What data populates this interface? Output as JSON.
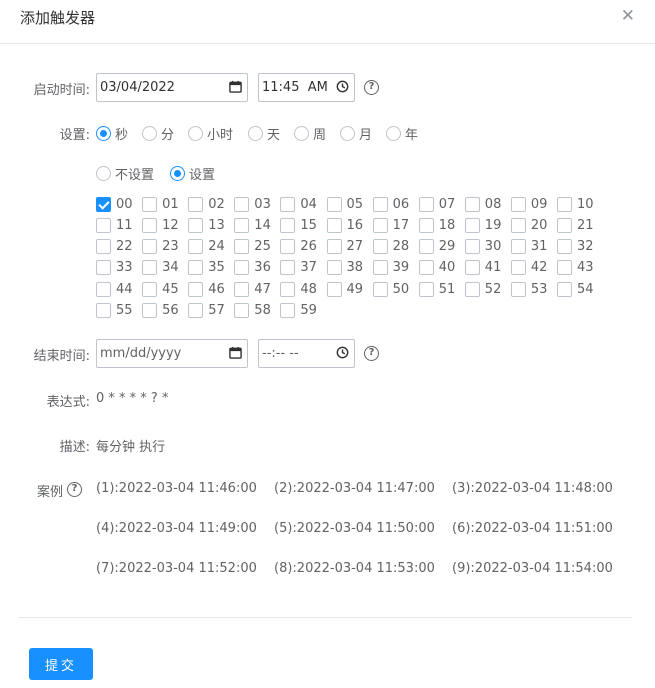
{
  "dialog": {
    "title": "添加触发器",
    "close_icon": "close-icon"
  },
  "start": {
    "label": "启动时间:",
    "date_value": "03/04/2022",
    "time_value": "11:45  AM",
    "date_icon": "calendar-icon",
    "time_icon": "clock-icon",
    "help": "?"
  },
  "settings": {
    "label": "设置:",
    "units": [
      {
        "label": "秒",
        "checked": true
      },
      {
        "label": "分",
        "checked": false
      },
      {
        "label": "小时",
        "checked": false
      },
      {
        "label": "天",
        "checked": false
      },
      {
        "label": "周",
        "checked": false
      },
      {
        "label": "月",
        "checked": false
      },
      {
        "label": "年",
        "checked": false
      }
    ],
    "modes": [
      {
        "label": "不设置",
        "checked": false
      },
      {
        "label": "设置",
        "checked": true
      }
    ],
    "seconds": [
      "00",
      "01",
      "02",
      "03",
      "04",
      "05",
      "06",
      "07",
      "08",
      "09",
      "10",
      "11",
      "12",
      "13",
      "14",
      "15",
      "16",
      "17",
      "18",
      "19",
      "20",
      "21",
      "22",
      "23",
      "24",
      "25",
      "26",
      "27",
      "28",
      "29",
      "30",
      "31",
      "32",
      "33",
      "34",
      "35",
      "36",
      "37",
      "38",
      "39",
      "40",
      "41",
      "42",
      "43",
      "44",
      "45",
      "46",
      "47",
      "48",
      "49",
      "50",
      "51",
      "52",
      "53",
      "54",
      "55",
      "56",
      "57",
      "58",
      "59"
    ],
    "checked_seconds": [
      "00"
    ]
  },
  "end": {
    "label": "结束时间:",
    "date_placeholder": "mm/dd/yyyy",
    "time_placeholder": "--:-- --",
    "help": "?"
  },
  "expression": {
    "label": "表达式:",
    "value": "0 * * * * ? *"
  },
  "description": {
    "label": "描述:",
    "value": "每分钟 执行"
  },
  "examples": {
    "label": "案例",
    "help": "?",
    "items": [
      "(1):2022-03-04 11:46:00",
      "(2):2022-03-04 11:47:00",
      "(3):2022-03-04 11:48:00",
      "(4):2022-03-04 11:49:00",
      "(5):2022-03-04 11:50:00",
      "(6):2022-03-04 11:51:00",
      "(7):2022-03-04 11:52:00",
      "(8):2022-03-04 11:53:00",
      "(9):2022-03-04 11:54:00"
    ]
  },
  "submit": {
    "label": "提交"
  },
  "colors": {
    "primary": "#1890ff",
    "border": "#c0c4cc",
    "text": "#606266"
  }
}
